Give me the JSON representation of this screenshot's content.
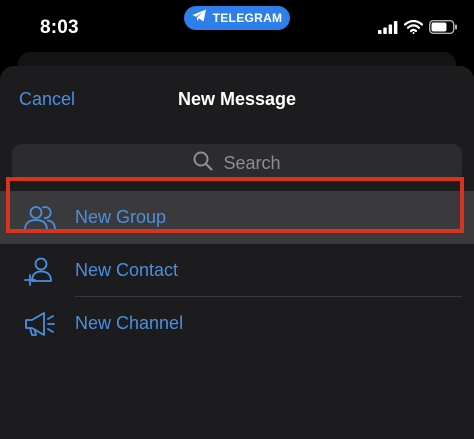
{
  "status_bar": {
    "time": "8:03",
    "app_pill": "TELEGRAM",
    "signal_icon": "cellular-signal-icon",
    "wifi_icon": "wifi-icon",
    "battery_icon": "battery-icon"
  },
  "header": {
    "cancel_label": "Cancel",
    "title": "New Message"
  },
  "search": {
    "placeholder": "Search",
    "icon": "search-icon"
  },
  "menu": {
    "items": [
      {
        "label": "New Group",
        "icon": "group-icon",
        "highlighted": true
      },
      {
        "label": "New Contact",
        "icon": "add-contact-icon",
        "highlighted": false
      },
      {
        "label": "New Channel",
        "icon": "megaphone-icon",
        "highlighted": false
      }
    ]
  },
  "colors": {
    "accent": "#4a8fe0",
    "sheet_background": "#1c1c1e",
    "highlight_row": "#3a3a3c",
    "annotation_border": "#d9321f",
    "pill": "#2f7fea"
  }
}
